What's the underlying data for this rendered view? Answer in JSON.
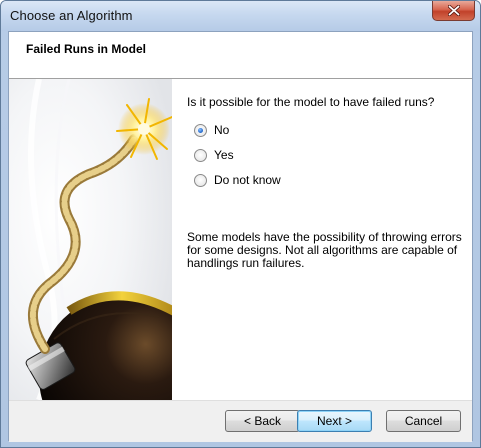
{
  "window": {
    "title": "Choose an Algorithm"
  },
  "header": {
    "title": "Failed Runs in Model"
  },
  "main": {
    "question": "Is it possible for the model to have failed runs?",
    "options": [
      {
        "label": "No",
        "checked": true
      },
      {
        "label": "Yes",
        "checked": false
      },
      {
        "label": "Do not know",
        "checked": false
      }
    ],
    "description": "Some models have the possibility of throwing errors for some designs. Not all algorithms are capable of handlings run failures."
  },
  "footer": {
    "back_label": "< Back",
    "next_label": "Next >",
    "cancel_label": "Cancel"
  },
  "icons": {
    "close": "close-icon",
    "illustration": "bomb-illustration"
  },
  "colors": {
    "accent": "#3c7fb1",
    "titlebar": "#c6d8ef",
    "close": "#c1412a"
  }
}
